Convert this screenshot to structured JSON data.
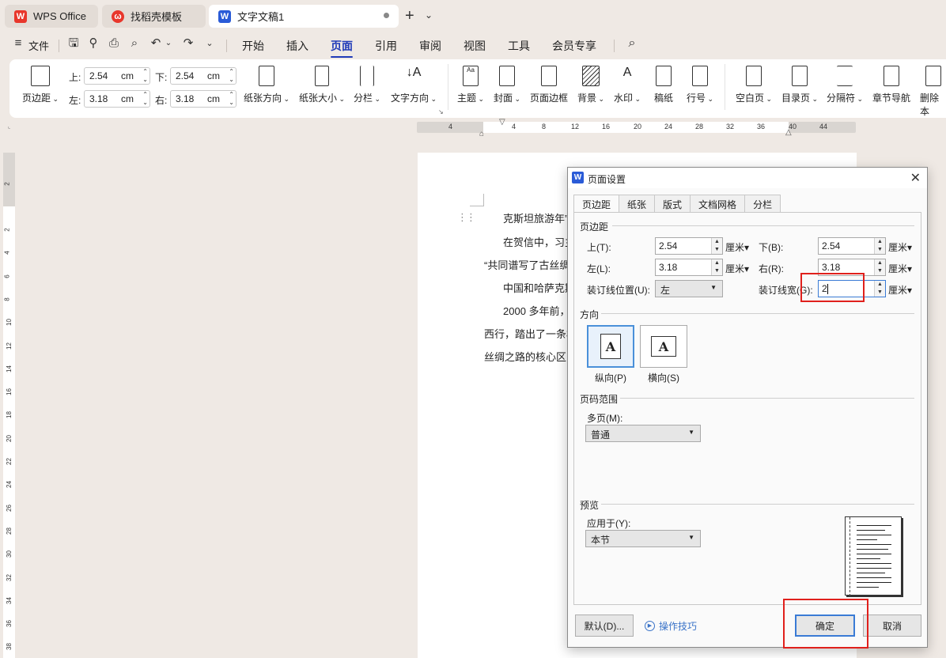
{
  "tabs": [
    {
      "label": "WPS Office",
      "logo": "wps-logo"
    },
    {
      "label": "找稻壳模板",
      "logo": "docer-logo"
    },
    {
      "label": "文字文稿1",
      "logo": "writer-logo"
    }
  ],
  "menubar": {
    "file": "文件",
    "items": [
      "开始",
      "插入",
      "页面",
      "引用",
      "审阅",
      "视图",
      "工具",
      "会员专享"
    ],
    "active": "页面"
  },
  "ribbon": {
    "margins": "页边距",
    "top_label": "上:",
    "top_value": "2.54",
    "bottom_label": "下:",
    "bottom_value": "2.54",
    "left_label": "左:",
    "left_value": "3.18",
    "right_label": "右:",
    "right_value": "3.18",
    "unit": "cm",
    "orientation": "纸张方向",
    "size": "纸张大小",
    "columns": "分栏",
    "text_direction": "文字方向",
    "theme": "主题",
    "cover": "封面",
    "page_border": "页面边框",
    "background": "背景",
    "watermark": "水印",
    "manuscript": "稿纸",
    "line_number": "行号",
    "blank_page": "空白页",
    "toc_page": "目录页",
    "separator": "分隔符",
    "chapter_nav": "章节导航",
    "delete_page": "删除本"
  },
  "ruler": {
    "h_ticks": [
      "4",
      "4",
      "8",
      "12",
      "16",
      "20",
      "24",
      "28",
      "32",
      "36",
      "40",
      "44"
    ],
    "v_ticks": [
      "2",
      "2",
      "4",
      "6",
      "8",
      "10",
      "12",
      "14",
      "16",
      "18",
      "20",
      "22",
      "24",
      "26",
      "28",
      "30",
      "32",
      "34",
      "36",
      "38"
    ]
  },
  "document": {
    "lines": [
      "克斯坦旅游年”",
      "在贺信中，习主",
      "“共同谱写了古丝绸",
      "中国和哈萨克斯",
      "2000 多年前，",
      "西行，踏出了一条横",
      "丝绸之路的核心区"
    ]
  },
  "dialog": {
    "title": "页面设置",
    "tabs": [
      "页边距",
      "纸张",
      "版式",
      "文档网格",
      "分栏"
    ],
    "active_tab": "页边距",
    "margins_section": "页边距",
    "top_label": "上(T):",
    "top_value": "2.54",
    "bottom_label": "下(B):",
    "bottom_value": "2.54",
    "left_label": "左(L):",
    "left_value": "3.18",
    "right_label": "右(R):",
    "right_value": "3.18",
    "gutter_pos_label": "装订线位置(U):",
    "gutter_pos_value": "左",
    "gutter_label": "装订线宽(G):",
    "gutter_value": "2",
    "unit": "厘米",
    "orientation_section": "方向",
    "portrait": "纵向(P)",
    "landscape": "横向(S)",
    "page_range_section": "页码范围",
    "multi_page_label": "多页(M):",
    "multi_page_value": "普通",
    "preview_section": "预览",
    "apply_to_label": "应用于(Y):",
    "apply_to_value": "本节",
    "default_button": "默认(D)...",
    "tips_link": "操作技巧",
    "ok_button": "确定",
    "cancel_button": "取消"
  },
  "colors": {
    "accent": "#1f3ab8",
    "highlight_box": "#e0201c",
    "wps_red": "#e8372c",
    "writer_blue": "#2a5bd7"
  }
}
